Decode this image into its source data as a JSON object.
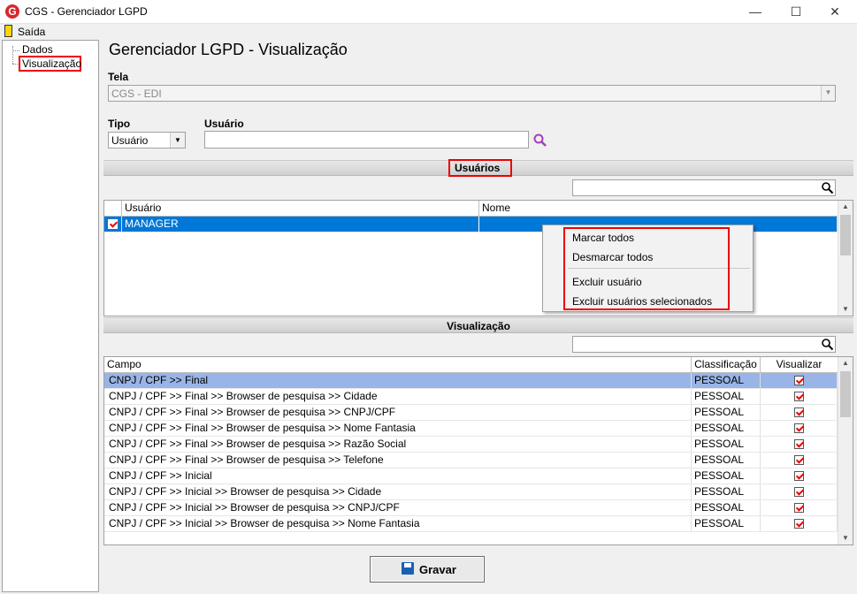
{
  "window": {
    "title": "CGS - Gerenciador LGPD",
    "app_icon": "G",
    "minimize": "—",
    "maximize": "☐",
    "close": "✕"
  },
  "menu": {
    "exit_label": "Saída"
  },
  "tree": {
    "items": [
      {
        "label": "Dados"
      },
      {
        "label": "Visualização"
      }
    ]
  },
  "page": {
    "title": "Gerenciador LGPD - Visualização"
  },
  "form": {
    "tela_label": "Tela",
    "tela_value": "CGS - EDI",
    "tipo_label": "Tipo",
    "tipo_value": "Usuário",
    "usuario_label": "Usuário",
    "usuario_value": ""
  },
  "users_section": {
    "title": "Usuários",
    "search_value": "",
    "columns": [
      "Usuário",
      "Nome"
    ],
    "rows": [
      {
        "usuario": "MANAGER",
        "nome": "",
        "checked": true
      }
    ]
  },
  "context_menu": {
    "items": [
      "Marcar todos",
      "Desmarcar todos",
      "Excluir usuário",
      "Excluir usuários selecionados"
    ]
  },
  "view_section": {
    "title": "Visualização",
    "search_value": "",
    "columns": [
      "Campo",
      "Classificação",
      "Visualizar"
    ],
    "rows": [
      {
        "campo": "CNPJ / CPF >> Final",
        "classificacao": "PESSOAL",
        "visualizar": true
      },
      {
        "campo": "CNPJ / CPF >> Final >> Browser de pesquisa >> Cidade",
        "classificacao": "PESSOAL",
        "visualizar": true
      },
      {
        "campo": "CNPJ / CPF >> Final >> Browser de pesquisa >> CNPJ/CPF",
        "classificacao": "PESSOAL",
        "visualizar": true
      },
      {
        "campo": "CNPJ / CPF >> Final >> Browser de pesquisa >> Nome Fantasia",
        "classificacao": "PESSOAL",
        "visualizar": true
      },
      {
        "campo": "CNPJ / CPF >> Final >> Browser de pesquisa >> Razão Social",
        "classificacao": "PESSOAL",
        "visualizar": true
      },
      {
        "campo": "CNPJ / CPF >> Final >> Browser de pesquisa >> Telefone",
        "classificacao": "PESSOAL",
        "visualizar": true
      },
      {
        "campo": "CNPJ / CPF >> Inicial",
        "classificacao": "PESSOAL",
        "visualizar": true
      },
      {
        "campo": "CNPJ / CPF >> Inicial >> Browser de pesquisa >> Cidade",
        "classificacao": "PESSOAL",
        "visualizar": true
      },
      {
        "campo": "CNPJ / CPF >> Inicial >> Browser de pesquisa >> CNPJ/CPF",
        "classificacao": "PESSOAL",
        "visualizar": true
      },
      {
        "campo": "CNPJ / CPF >> Inicial >> Browser de pesquisa >> Nome Fantasia",
        "classificacao": "PESSOAL",
        "visualizar": true
      }
    ]
  },
  "footer": {
    "save_label": "Gravar"
  },
  "colors": {
    "selection": "#0078d7",
    "highlight_row": "#99b4e6",
    "annotation_red": "#e00000",
    "accent_purple": "#a040c0"
  }
}
